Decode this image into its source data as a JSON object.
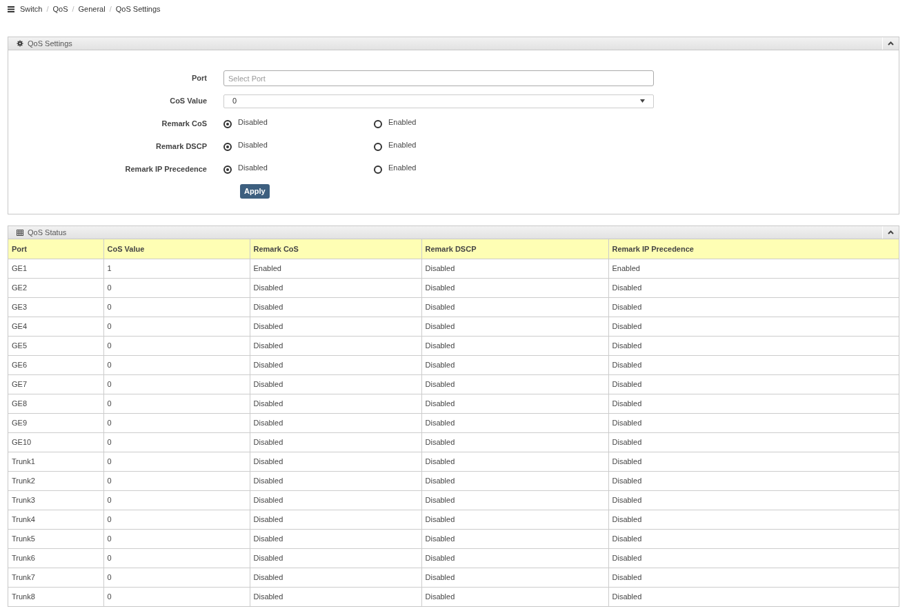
{
  "breadcrumb": [
    "Switch",
    "QoS",
    "General",
    "QoS Settings"
  ],
  "breadcrumb_separator": "/",
  "settings_panel": {
    "title": "QoS Settings",
    "fields": [
      {
        "kind": "text",
        "label": "Port",
        "placeholder": "Select Port"
      },
      {
        "kind": "select",
        "label": "CoS Value",
        "value": "0"
      },
      {
        "kind": "radio",
        "label": "Remark CoS",
        "options": [
          {
            "label": "Disabled",
            "selected": true
          },
          {
            "label": "Enabled",
            "selected": false
          }
        ]
      },
      {
        "kind": "radio",
        "label": "Remark DSCP",
        "options": [
          {
            "label": "Disabled",
            "selected": true
          },
          {
            "label": "Enabled",
            "selected": false
          }
        ]
      },
      {
        "kind": "radio",
        "label": "Remark IP Precedence",
        "options": [
          {
            "label": "Disabled",
            "selected": true
          },
          {
            "label": "Enabled",
            "selected": false
          }
        ]
      }
    ],
    "button": "Apply"
  },
  "status_panel": {
    "title": "QoS Status",
    "columns": [
      "Port",
      "CoS Value",
      "Remark CoS",
      "Remark DSCP",
      "Remark IP Precedence"
    ],
    "rows": [
      [
        "GE1",
        "1",
        "Enabled",
        "Disabled",
        "Enabled"
      ],
      [
        "GE2",
        "0",
        "Disabled",
        "Disabled",
        "Disabled"
      ],
      [
        "GE3",
        "0",
        "Disabled",
        "Disabled",
        "Disabled"
      ],
      [
        "GE4",
        "0",
        "Disabled",
        "Disabled",
        "Disabled"
      ],
      [
        "GE5",
        "0",
        "Disabled",
        "Disabled",
        "Disabled"
      ],
      [
        "GE6",
        "0",
        "Disabled",
        "Disabled",
        "Disabled"
      ],
      [
        "GE7",
        "0",
        "Disabled",
        "Disabled",
        "Disabled"
      ],
      [
        "GE8",
        "0",
        "Disabled",
        "Disabled",
        "Disabled"
      ],
      [
        "GE9",
        "0",
        "Disabled",
        "Disabled",
        "Disabled"
      ],
      [
        "GE10",
        "0",
        "Disabled",
        "Disabled",
        "Disabled"
      ],
      [
        "Trunk1",
        "0",
        "Disabled",
        "Disabled",
        "Disabled"
      ],
      [
        "Trunk2",
        "0",
        "Disabled",
        "Disabled",
        "Disabled"
      ],
      [
        "Trunk3",
        "0",
        "Disabled",
        "Disabled",
        "Disabled"
      ],
      [
        "Trunk4",
        "0",
        "Disabled",
        "Disabled",
        "Disabled"
      ],
      [
        "Trunk5",
        "0",
        "Disabled",
        "Disabled",
        "Disabled"
      ],
      [
        "Trunk6",
        "0",
        "Disabled",
        "Disabled",
        "Disabled"
      ],
      [
        "Trunk7",
        "0",
        "Disabled",
        "Disabled",
        "Disabled"
      ],
      [
        "Trunk8",
        "0",
        "Disabled",
        "Disabled",
        "Disabled"
      ]
    ]
  }
}
